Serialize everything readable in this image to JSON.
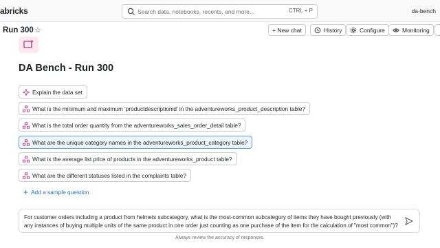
{
  "topbar": {
    "brand": "abricks",
    "search_placeholder": "Search data, notebooks, recents, and more...",
    "search_shortcut": "CTRL + P",
    "workspace": "da-bench"
  },
  "titlebar": {
    "run_title": "Run 300",
    "buttons": {
      "new_chat": "+ New chat",
      "history": "History",
      "configure": "Configure",
      "monitoring": "Monitoring"
    }
  },
  "main": {
    "title": "DA Bench - Run 300",
    "suggestions": [
      "Explain the data set",
      "What is the minimum and maximum 'productdescriptionid' in the adventureworks_product_description table?",
      "What is the total order quantity from the adventureworks_sales_order_detail table?",
      "What are the unique category names in the adventureworks_product_category table?",
      "What is the average list price of products in the adventureworks_product table?",
      "What are the different statuses listed in the complaints table?"
    ],
    "add_sample": "Add a sample question"
  },
  "prompt": {
    "value": "For customer orders including a product from helmets subcategory, what is the most-common subcategory of items they have bought previously (with any instances of buying multiple units of the same product in one order just counting as one purchase of the item for the calculation of \"most common\")?"
  },
  "footer": {
    "note": "Always review the accuracy of responses."
  },
  "colors": {
    "accent": "#2272b4",
    "selected_border": "#5aa0db",
    "logo_bg": "#fbe9f1",
    "logo_fg": "#b8357a"
  }
}
